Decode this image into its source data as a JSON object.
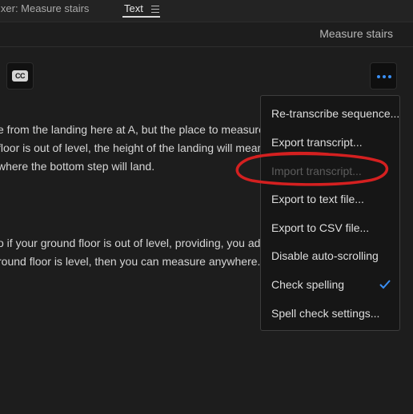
{
  "tabs": {
    "mixer_label": "ixer: Measure stairs",
    "text_label": "Text"
  },
  "sequence": {
    "title": "Measure stairs"
  },
  "toolbar": {
    "cc_label": "CC"
  },
  "transcript": {
    "lines": [
      "e from the landing here at A, but the place to measure",
      "floor is out of level, the height of the landing will mean",
      "where the bottom step will land.",
      "o if your ground floor is out of level, providing, you add",
      "round floor is level, then you can measure anywhere."
    ]
  },
  "menu": {
    "items": [
      {
        "label": "Re-transcribe sequence...",
        "enabled": true
      },
      {
        "label": "Export transcript...",
        "enabled": true
      },
      {
        "label": "Import transcript...",
        "enabled": false
      },
      {
        "label": "Export to text file...",
        "enabled": true
      },
      {
        "label": "Export to CSV file...",
        "enabled": true
      },
      {
        "label": "Disable auto-scrolling",
        "enabled": true
      },
      {
        "label": "Check spelling",
        "enabled": true,
        "checked": true
      },
      {
        "label": "Spell check settings...",
        "enabled": true
      }
    ]
  },
  "colors": {
    "accent": "#3a8ff5",
    "annotation": "#d42020",
    "background": "#1d1d1d"
  }
}
